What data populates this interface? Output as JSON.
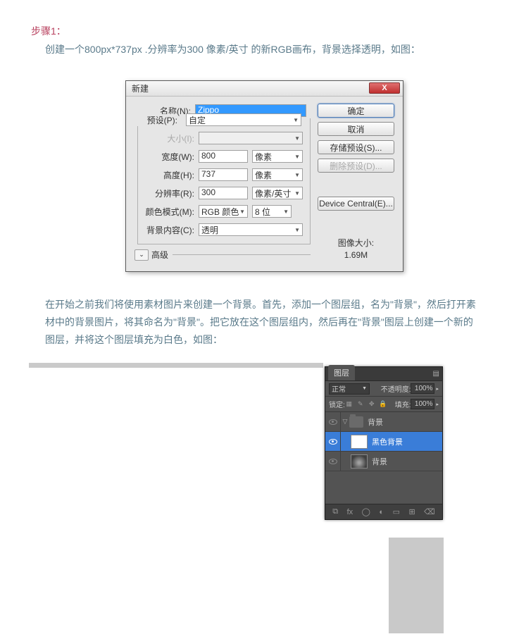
{
  "step": {
    "heading": "步骤1："
  },
  "intro": "创建一个800px*737px .分辨率为300 像素/英寸 的新RGB画布，背景选择透明，如图：",
  "para2": "在开始之前我们将使用素材图片来创建一个背景。首先，添加一个图层组，名为\"背景\"，然后打开素材中的背景图片，将其命名为\"背景\"。把它放在这个图层组内，然后再在\"背景\"图层上创建一个新的图层，并将这个图层填充为白色，如图：",
  "dialog": {
    "title": "新建",
    "close": "X",
    "labels": {
      "name": "名称(N):",
      "preset": "预设(P):",
      "size": "大小(I):",
      "width": "宽度(W):",
      "height": "高度(H):",
      "resolution": "分辨率(R):",
      "colorMode": "颜色模式(M):",
      "bgContents": "背景内容(C):"
    },
    "values": {
      "name": "Zippo",
      "preset": "自定",
      "size": "",
      "width": "800",
      "widthUnit": "像素",
      "height": "737",
      "heightUnit": "像素",
      "resolution": "300",
      "resolutionUnit": "像素/英寸",
      "colorMode": "RGB 颜色",
      "colorDepth": "8 位",
      "bgContents": "透明"
    },
    "advanced": "高级",
    "buttons": {
      "ok": "确定",
      "cancel": "取消",
      "savePreset": "存储预设(S)...",
      "deletePreset": "删除预设(D)...",
      "deviceCentral": "Device Central(E)..."
    },
    "imageSizeLabel": "图像大小:",
    "imageSizeValue": "1.69M"
  },
  "layers": {
    "tab": "图层",
    "blendMode": "正常",
    "opacityLabel": "不透明度:",
    "opacity": "100%",
    "lockLabel": "锁定:",
    "fillLabel": "填充:",
    "fill": "100%",
    "items": {
      "group": "背景",
      "layer1": "黑色背景",
      "layer2": "背景"
    },
    "footerIcons": {
      "fx": "fx",
      "mask": "◯",
      "adjust": "◐",
      "newGroup": "▭",
      "newLayer": "⊞",
      "trash": "🗑"
    }
  }
}
